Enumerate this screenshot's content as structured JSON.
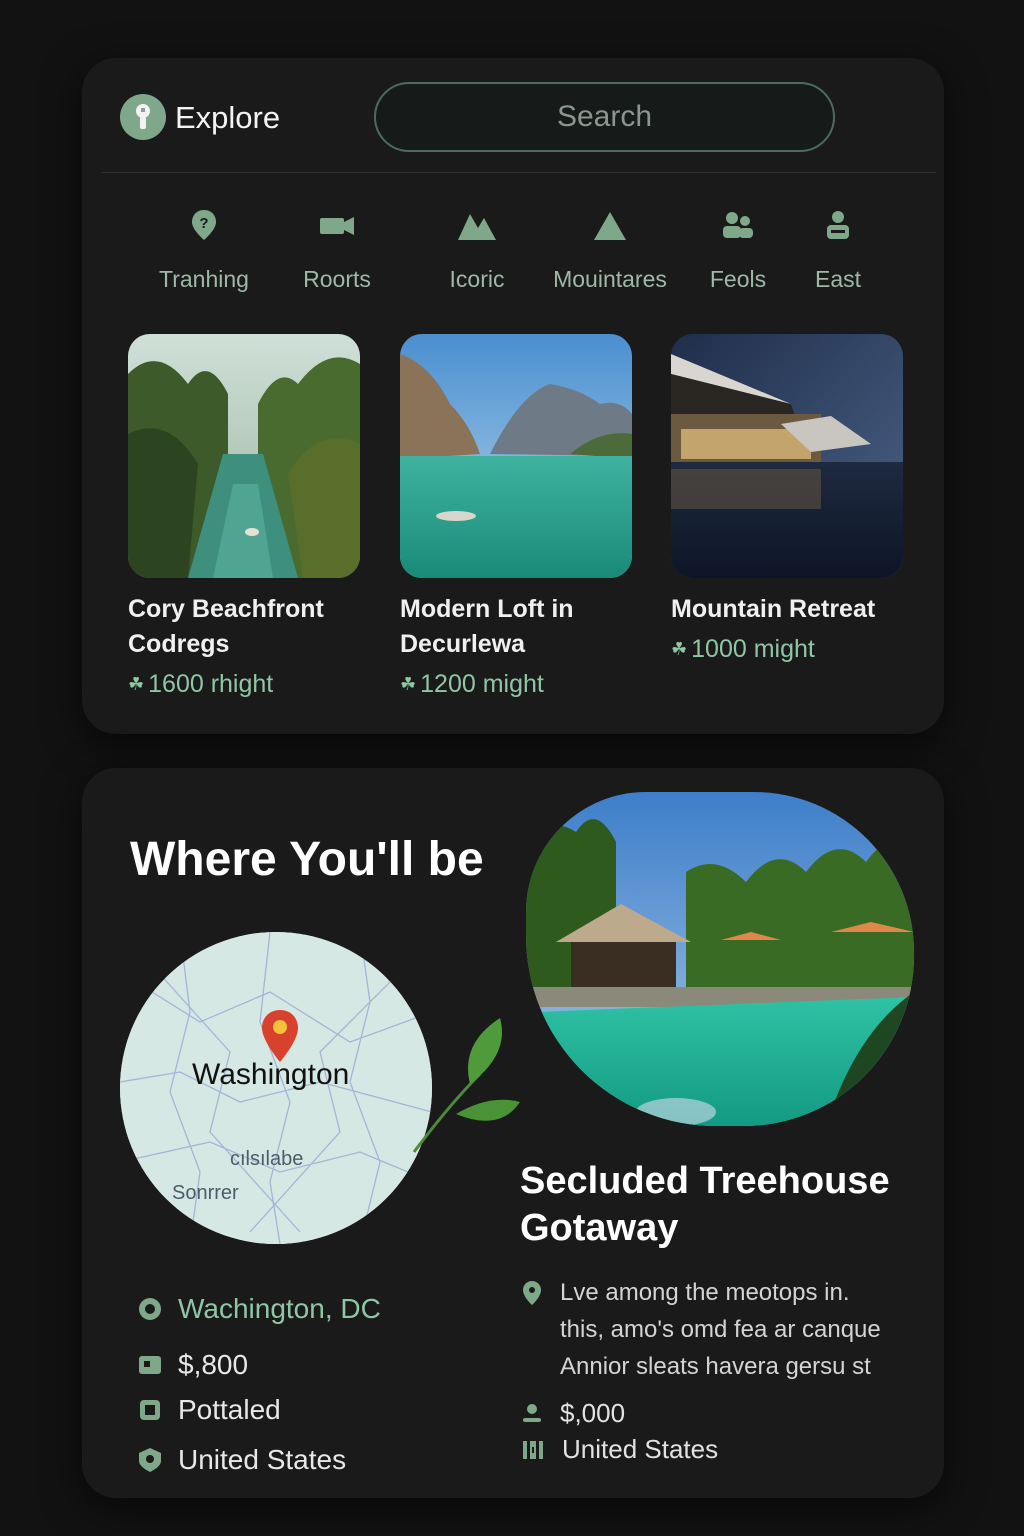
{
  "header": {
    "title": "Explore",
    "search_placeholder": "Search"
  },
  "categories": [
    {
      "label": "Tranhing",
      "icon": "help-circle-icon"
    },
    {
      "label": "Roorts",
      "icon": "video-camera-icon"
    },
    {
      "label": "Icoric",
      "icon": "mountains-icon"
    },
    {
      "label": "Mouintares",
      "icon": "triangle-icon"
    },
    {
      "label": "Feols",
      "icon": "people-icon"
    },
    {
      "label": "East",
      "icon": "person-icon"
    }
  ],
  "listings": [
    {
      "title_line1": "Cory Beachfront",
      "title_line2": "Codregs",
      "price": "1600 rhight",
      "image": "jungle-river-photo"
    },
    {
      "title_line1": "Modern Loft in",
      "title_line2": "Decurlewa",
      "price": "1200 might",
      "image": "lagoon-cliffs-photo"
    },
    {
      "title_line1": "Mountain Retreat",
      "title_line2": "",
      "price": "1000 might",
      "image": "lakeside-villa-photo"
    }
  ],
  "location": {
    "heading": "Where You'll be",
    "map_city": "Washington",
    "map_sub1": "cılsılabe",
    "map_sub2": "Sonrrer",
    "place": "Wachington, DC",
    "price": "$,800",
    "type": "Pottaled",
    "country": "United States"
  },
  "featured": {
    "title": "Secluded Treehouse Gotaway",
    "description": "Lve among the meotops in. this, amo's omd fea ar canque Annior sleats havera gersu st",
    "price": "$,000",
    "country": "United States"
  },
  "colors": {
    "accent": "#8fc7a5",
    "card": "#1a1a1a",
    "background": "#121212"
  }
}
